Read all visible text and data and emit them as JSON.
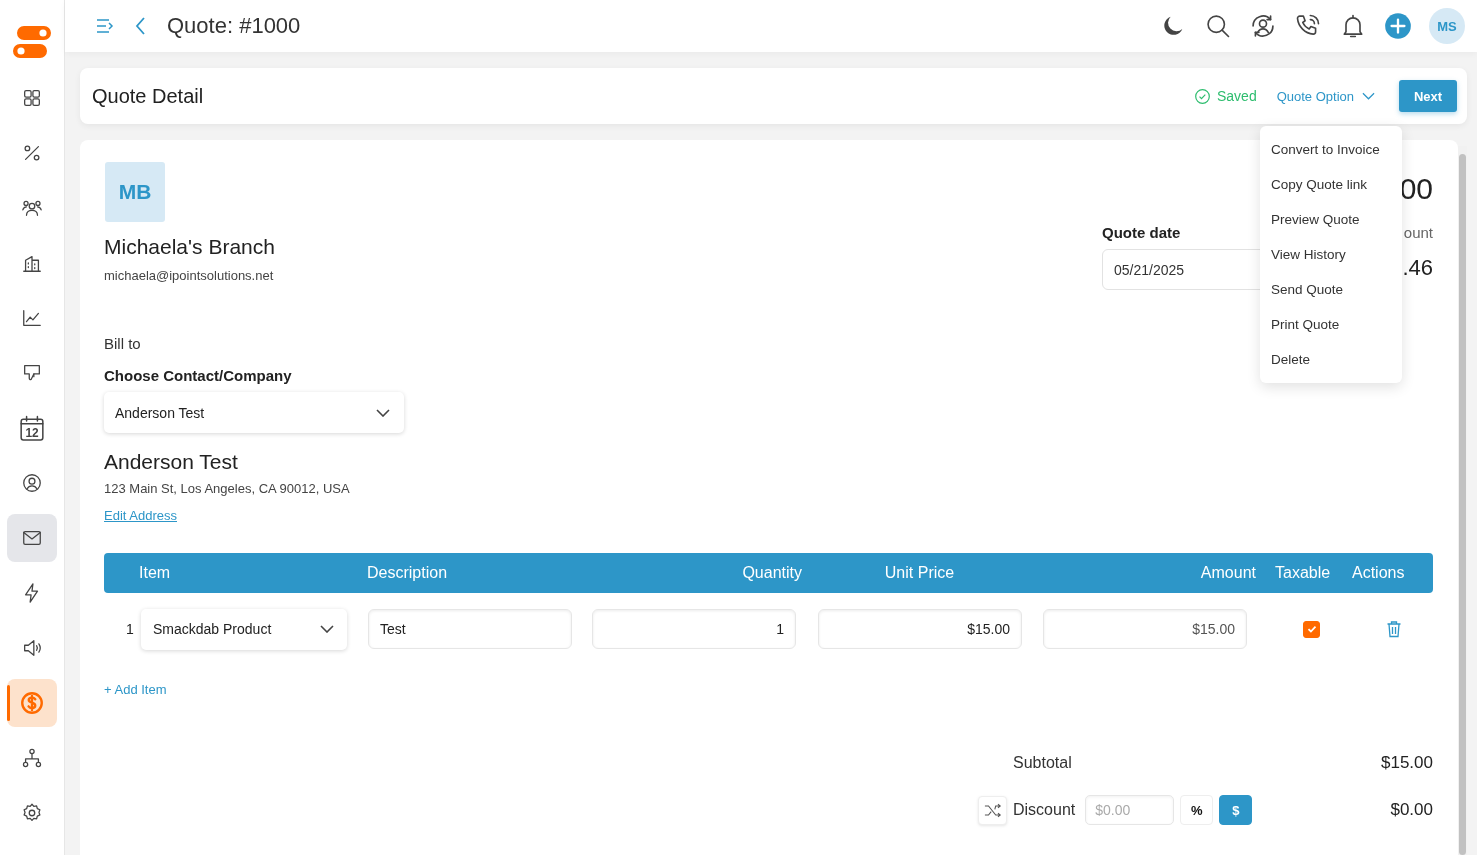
{
  "sidebar": {
    "items": [
      {
        "kind": "grid",
        "selected": false,
        "highlighted": false
      },
      {
        "kind": "percent",
        "selected": false,
        "highlighted": false
      },
      {
        "kind": "people",
        "selected": false,
        "highlighted": false
      },
      {
        "kind": "building",
        "selected": false,
        "highlighted": false
      },
      {
        "kind": "chart",
        "selected": false,
        "highlighted": false
      },
      {
        "kind": "thumbs-down",
        "selected": false,
        "highlighted": false
      },
      {
        "kind": "calendar",
        "label": "12",
        "selected": false,
        "highlighted": false
      },
      {
        "kind": "user",
        "selected": false,
        "highlighted": false
      },
      {
        "kind": "mail",
        "selected": false,
        "highlighted": true
      },
      {
        "kind": "bolt",
        "selected": false,
        "highlighted": false
      },
      {
        "kind": "speaker",
        "selected": false,
        "highlighted": false
      },
      {
        "kind": "dollar",
        "selected": true,
        "highlighted": false
      },
      {
        "kind": "hierarchy",
        "selected": false,
        "highlighted": false
      },
      {
        "kind": "gear",
        "selected": false,
        "highlighted": false
      }
    ]
  },
  "topbar": {
    "title": "Quote: #1000",
    "actions": [
      {
        "kind": "moon"
      },
      {
        "kind": "search"
      },
      {
        "kind": "user-sync"
      },
      {
        "kind": "phone"
      },
      {
        "kind": "bell"
      },
      {
        "kind": "plus"
      }
    ],
    "avatar": "MS"
  },
  "header": {
    "title": "Quote Detail",
    "saved_label": "Saved",
    "quote_option": {
      "label": "Quote Option",
      "expanded": true,
      "items": [
        "Convert to Invoice",
        "Copy Quote link",
        "Preview Quote",
        "View History",
        "Send Quote",
        "Print Quote",
        "Delete"
      ]
    },
    "next_button": "Next"
  },
  "company": {
    "initials": "MB",
    "name": "Michaela's Branch",
    "email": "michaela@ipointsolutions.net"
  },
  "summary_fragments": {
    "total": "00",
    "amount_label": "ount",
    "amount_value": ".46"
  },
  "quote_date": {
    "label": "Quote date",
    "value": "05/21/2025"
  },
  "bill_to": {
    "heading": "Bill to",
    "select_label": "Choose Contact/Company",
    "selected_contact": "Anderson Test",
    "contact_name": "Anderson Test",
    "address": "123 Main St, Los Angeles, CA 90012, USA",
    "edit_link": "Edit Address"
  },
  "table": {
    "columns": [
      "Item",
      "Description",
      "Quantity",
      "Unit Price",
      "Amount",
      "Taxable",
      "Actions"
    ],
    "rows": [
      {
        "number": "1",
        "item": "Smackdab Product",
        "description": "Test",
        "quantity": "1",
        "unit_price": "$15.00",
        "amount": "$15.00",
        "taxable": true
      }
    ]
  },
  "add_item": "+ Add Item",
  "totals": {
    "subtotal_label": "Subtotal",
    "subtotal": "$15.00",
    "discount": {
      "label": "Discount",
      "placeholder": "$0.00",
      "modes": [
        {
          "label": "%",
          "selected": false
        },
        {
          "label": "$",
          "selected": true
        }
      ],
      "value": "$0.00"
    }
  }
}
